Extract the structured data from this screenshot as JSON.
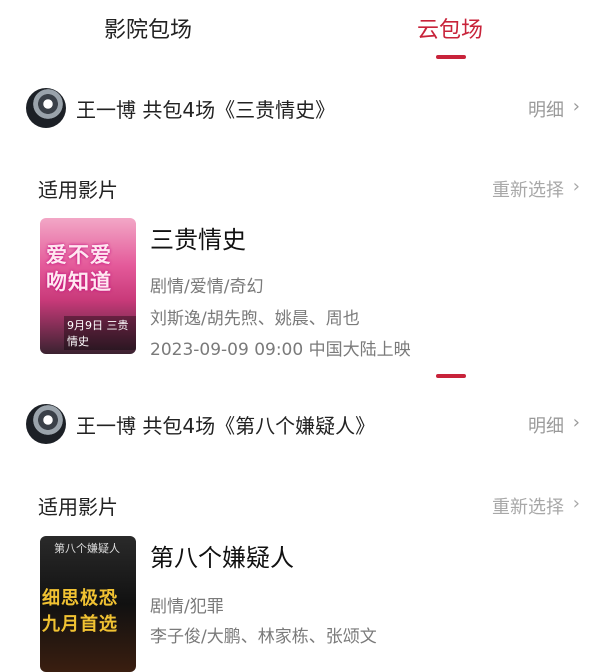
{
  "tabs": [
    {
      "label": "影院包场",
      "active": false
    },
    {
      "label": "云包场",
      "active": true
    }
  ],
  "accent_color": "#c8233a",
  "packages": [
    {
      "user": "王一博",
      "text": "王一博 共包4场《三贵情史》",
      "detail_label": "明细",
      "apply_title": "适用影片",
      "reselect_label": "重新选择",
      "movie": {
        "title": "三贵情史",
        "genres": "剧情/爱情/奇幻",
        "cast": "刘斯逸/胡先煦、姚晨、周也",
        "release": "2023-09-09 09:00 中国大陆上映",
        "poster_lines": [
          "爱不爱",
          "吻知道"
        ],
        "poster_caption": "9月9日 三贵情史"
      }
    },
    {
      "user": "王一博",
      "text": "王一博 共包4场《第八个嫌疑人》",
      "detail_label": "明细",
      "apply_title": "适用影片",
      "reselect_label": "重新选择",
      "movie": {
        "title": "第八个嫌疑人",
        "genres": "剧情/犯罪",
        "cast": "李子俊/大鹏、林家栋、张颂文",
        "poster_top": "第八个嫌疑人",
        "poster_lines": [
          "细思极恐",
          "九月首选"
        ]
      }
    }
  ],
  "chevron": "›"
}
